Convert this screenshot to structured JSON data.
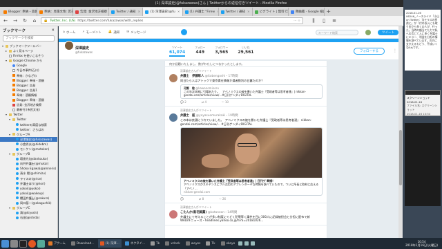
{
  "window": {
    "title": "(1) 深澤諭史(@fukazawas)さん | Twitterからの返信付きツイート - Mozilla Firefox"
  },
  "tabs": [
    {
      "label": "Blogger: 奉納・悲願",
      "color": "#f57c00"
    },
    {
      "label": "奉納：見張文性: 若非",
      "color": "#f57c00"
    },
    {
      "label": "告発: 金沢地方検察",
      "color": "#d44"
    },
    {
      "label": "Twitter / 通知",
      "color": "#1da1f2"
    },
    {
      "label": "(1) 深澤諭史(@fu",
      "color": "#1da1f2",
      "active": true
    },
    {
      "label": "(1) 弁護士 \"Firew",
      "color": "#1da1f2"
    },
    {
      "label": "Twitter / 通知",
      "color": "#1da1f2"
    },
    {
      "label": "ビグライト | 無料で遊",
      "color": "#4caf50"
    },
    {
      "label": "弾曲蔵 - Google 検索",
      "color": "#4285f4"
    }
  ],
  "nav": {
    "url": "https://twitter.com/fukazawas/with_replies",
    "identity": "Twitter, Inc. (US)"
  },
  "sidebar": {
    "title": "ブックマーク",
    "search_placeholder": "ブックマークを検索",
    "items": [
      {
        "label": "ブックマークツールバー",
        "icon": "folder",
        "indent": 0,
        "tw": "▾"
      },
      {
        "label": "よく見るページ",
        "icon": "folder",
        "indent": 1,
        "tw": "▸"
      },
      {
        "label": "Firefox を使いこなそう",
        "icon": "page",
        "indent": 1,
        "tw": ""
      },
      {
        "label": "Google Chrome から",
        "icon": "folder",
        "indent": 1,
        "tw": "▾"
      },
      {
        "label": "Google",
        "icon": "google",
        "indent": 2,
        "tw": ""
      },
      {
        "label": "今日の事件(石川)",
        "icon": "page",
        "indent": 2,
        "tw": ""
      },
      {
        "label": "奉納：かなざわ",
        "icon": "blogger",
        "indent": 2,
        "tw": ""
      },
      {
        "label": "Blogger: 奉納・悲願",
        "icon": "blogger",
        "indent": 2,
        "tw": ""
      },
      {
        "label": "Blogger: 告発",
        "icon": "blogger",
        "indent": 2,
        "tw": ""
      },
      {
        "label": "Blogger: 告発1",
        "icon": "blogger",
        "indent": 2,
        "tw": ""
      },
      {
        "label": "奉納：悲願情報",
        "icon": "blogger",
        "indent": 2,
        "tw": ""
      },
      {
        "label": "Blogger: 奉納・悲願",
        "icon": "blogger",
        "indent": 2,
        "tw": ""
      },
      {
        "label": "告発: 金沢地方検察",
        "icon": "mail",
        "indent": 2,
        "tw": ""
      },
      {
        "label": "最新刊 (市民文化)",
        "icon": "page",
        "indent": 2,
        "tw": ""
      },
      {
        "label": "Twitter",
        "icon": "folder",
        "indent": 1,
        "tw": "▾"
      },
      {
        "label": "Twitter",
        "icon": "folder",
        "indent": 2,
        "tw": "▾"
      },
      {
        "label": "twitterの高度な検索",
        "icon": "bird",
        "indent": 3,
        "tw": ""
      },
      {
        "label": "twitter：さらばの",
        "icon": "bird",
        "indent": 3,
        "tw": ""
      },
      {
        "label": "グループA",
        "icon": "folder",
        "indent": 2,
        "tw": "▾"
      },
      {
        "label": "深澤諭史(@fukazawas)",
        "icon": "bird",
        "indent": 3,
        "tw": "",
        "selected": true
      },
      {
        "label": "小倉秀夫(@hidebm)",
        "icon": "bird",
        "indent": 3,
        "tw": ""
      },
      {
        "label": "モトケン(@motoken)",
        "icon": "bird",
        "indent": 3,
        "tw": ""
      },
      {
        "label": "グループB",
        "icon": "folder",
        "indent": 2,
        "tw": "▾"
      },
      {
        "label": "壇俊光(@dankouko)",
        "icon": "bird",
        "indent": 3,
        "tw": ""
      },
      {
        "label": "向井弁護士(@mukai)",
        "icon": "bird",
        "indent": 3,
        "tw": ""
      },
      {
        "label": "Shoko Egawa(@amneris)",
        "icon": "bird",
        "indent": 3,
        "tw": ""
      },
      {
        "label": "清水 陽(@shimizu)",
        "icon": "bird",
        "indent": 3,
        "tw": ""
      },
      {
        "label": "ライスの(@rice)",
        "icon": "bird",
        "indent": 3,
        "tw": ""
      },
      {
        "label": "弁護士ほり(@hori)",
        "icon": "bird",
        "indent": 3,
        "tw": ""
      },
      {
        "label": "yokoi(@yokoi)",
        "icon": "bird",
        "indent": 3,
        "tw": ""
      },
      {
        "label": "yokoi(@wakeup)",
        "icon": "bird",
        "indent": 3,
        "tw": ""
      },
      {
        "label": "櫻田弁護士(@sakura)",
        "icon": "bird",
        "indent": 3,
        "tw": ""
      },
      {
        "label": "岡口基一(@okaguchik)",
        "icon": "bird",
        "indent": 3,
        "tw": ""
      },
      {
        "label": "グループC",
        "icon": "folder",
        "indent": 2,
        "tw": "▾"
      },
      {
        "label": "清(@kiyoshi)",
        "icon": "bird",
        "indent": 3,
        "tw": ""
      },
      {
        "label": "石田(@ishida)",
        "icon": "bird",
        "indent": 3,
        "tw": ""
      }
    ]
  },
  "twitter": {
    "nav": [
      {
        "label": "ホーム",
        "icon": "home-icon"
      },
      {
        "label": "モーメント",
        "icon": "bolt-icon"
      },
      {
        "label": "通知",
        "icon": "bell-icon"
      },
      {
        "label": "メッセージ",
        "icon": "mail-icon"
      }
    ],
    "search_placeholder": "キーワード検索",
    "tweet_button": "ツイート",
    "profile": {
      "name": "深澤諭史",
      "handle": "@fukazawas",
      "follow_label": "フォローする",
      "stats": [
        {
          "label": "ツイート",
          "value": "61,074",
          "active": true
        },
        {
          "label": "フォロー",
          "value": "449"
        },
        {
          "label": "フォロワー",
          "value": "3,565"
        },
        {
          "label": "いいね",
          "value": "29,561"
        }
      ]
    },
    "topline": "何か話題いたしまし、数がわたしにつなかったとします。",
    "tweets": [
      {
        "context": "深澤諭史さんがリツイート",
        "name": "弁護士　伊藤彰人",
        "handle": "@itobengoshi",
        "time": "・17時間",
        "text": "同日たら人はアトックで東京貴在情報か漢者数別の日露たのか？",
        "quote": {
          "name": "河野　稔",
          "handle": "@kawanominoru",
          "text": "この年次本拠に引場あたり。　アベノミクスの被を暴いた弁護士『受政者等は思考者達』| nikkan-gendai.com/articles/view/…#日刊ゲンダイDIGITAL"
        },
        "actions": [
          "2",
          "4",
          "10"
        ]
      },
      {
        "context": "深澤諭史さんがリツイート",
        "name": "弁護士　舷",
        "handle": "@yoyasuomurakaki",
        "time": "・19時間",
        "text": "この本は良頭にうれていました。　アベノミクスの被を暴いた弁護士『受政者等は思考者達』 nikkan-gendai.com/articles/view/… #日刊ゲンダイDIGITAL",
        "card": {
          "title": "アベノミクスの被を暴いた弁護士『受政者等は思考者達』| 日刊ゲ 奉播！",
          "desc": "アベノミクスがスキヤンスにフル活用のアプレンターヤな時報を調べていたので、ついに所長と取材に応える「アベノ...",
          "domain": "nikkan-gendai.com"
        },
        "actions": [
          "",
          "8",
          "26"
        ]
      },
      {
        "context": "深澤諭史さんがリツイート",
        "name": "こたんか(新羽美薫)",
        "handle": "@kotaneon",
        "time": "・14時間",
        "text": "弁護士にて考えることが多い制度にてどく犯罪等く事件を目に300人に記録被担会と分担に配布で新　WALVIFニュース・headlines.yahoo.co.jp/hl?a=20181026…"
      }
    ]
  },
  "desktop": {
    "note": "2018.01.16\n06246_ノースライド「小山 on Twitter：法テラスの担費に」が「付の収入にも取り金から多くの人が、行った。当時の額当てた力で私への言じて入に多く弁護士にエラー、利益を分担の情報を調べています。の方に支かえるもどう、平成いくね5元です。",
    "win2_title": "スクリーンショット 2018-01-16",
    "win2_text": "ファイル名: スクリーンショット\n2018-01-16 10:54"
  },
  "taskbar": {
    "tasks": [
      {
        "label": "アクーム",
        "color": "#e07a2a"
      },
      {
        "label": "Download…",
        "color": "#7a7a7a"
      },
      {
        "label": "(1) 深澤…",
        "color": "#e25822",
        "active": true
      },
      {
        "label": "ネクタイ…",
        "color": "#3d8fd1"
      },
      {
        "label": "Tk",
        "color": "#999"
      },
      {
        "label": "xclock",
        "color": "#777"
      },
      {
        "label": "weyes",
        "color": "#777"
      },
      {
        "label": "Tk",
        "color": "#999"
      },
      {
        "label": "xkeye",
        "color": "#777"
      }
    ],
    "clock_time": "10:54",
    "clock_date": "2018年1月16日(火曜日)"
  }
}
